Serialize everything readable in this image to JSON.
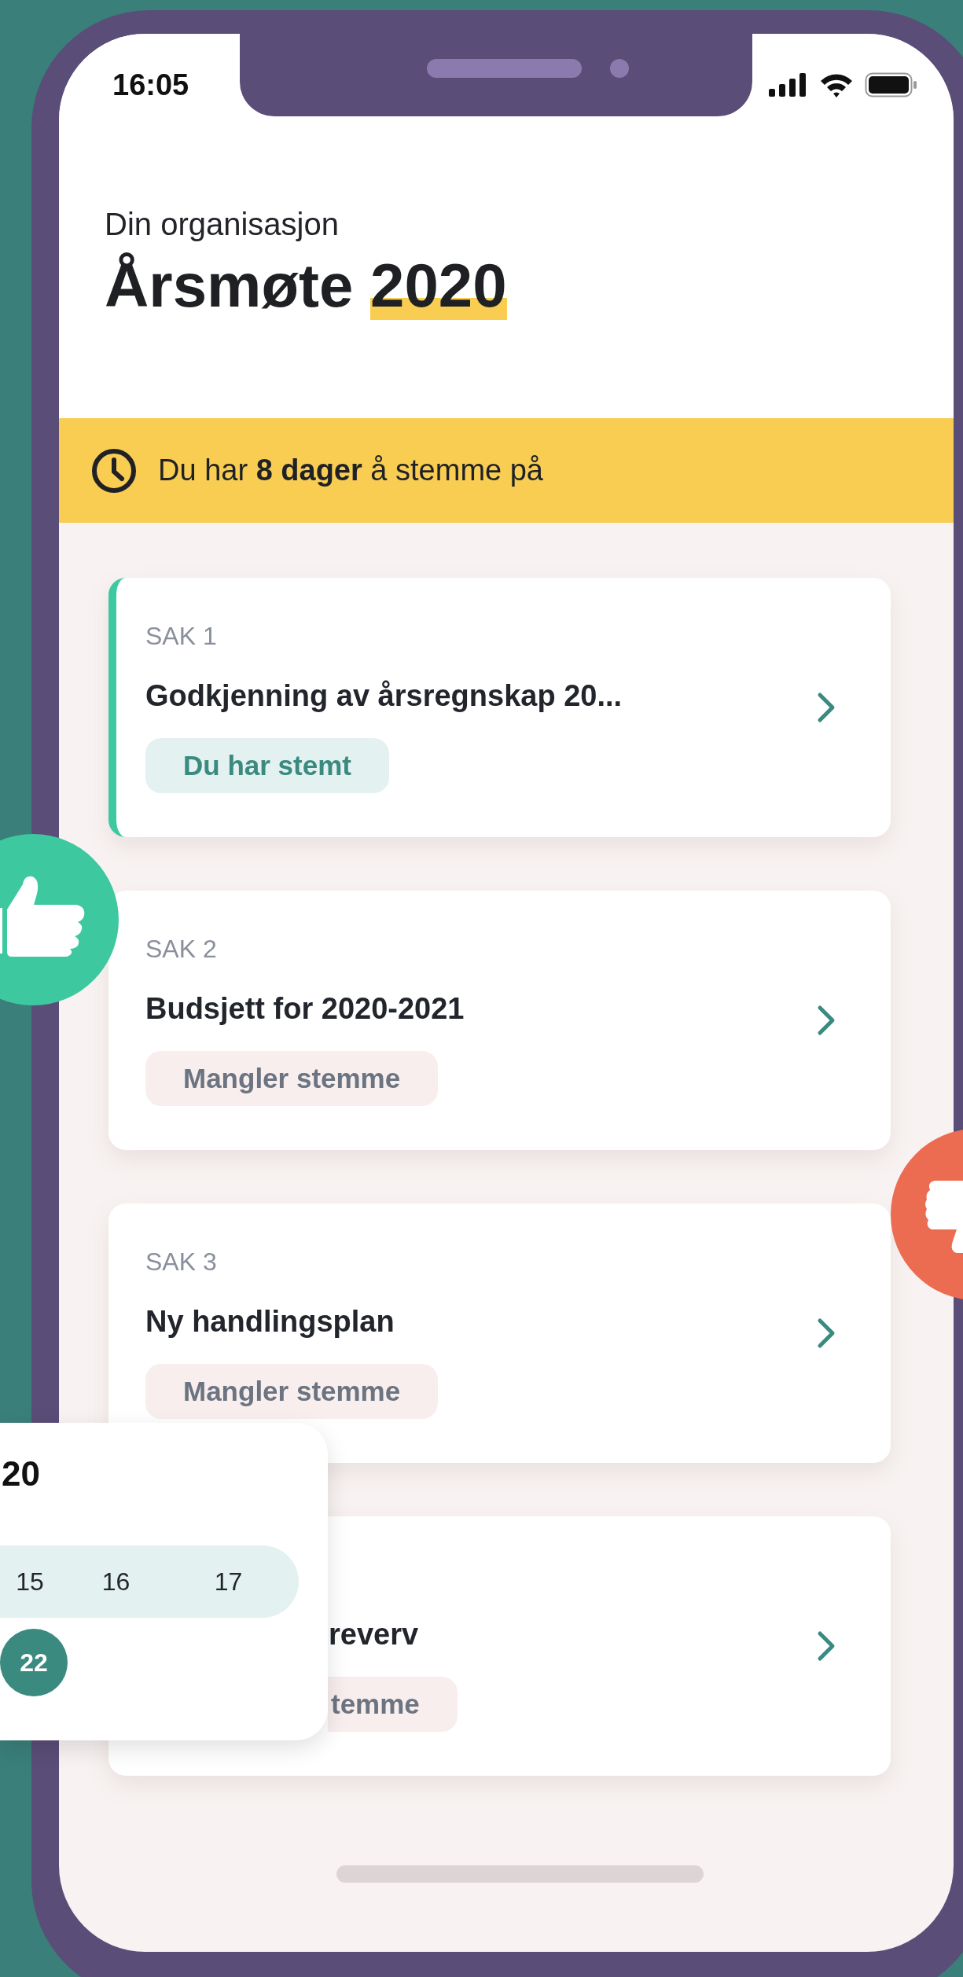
{
  "status_bar": {
    "time": "16:05"
  },
  "header": {
    "subtitle": "Din organisasjon",
    "title": "Årsmøte",
    "title_highlight": "2020"
  },
  "banner": {
    "text": "Du har **8 dager** å stemme på"
  },
  "cases": [
    {
      "label": "SAK 1",
      "title": "Godkjenning av årsregnskap 20...",
      "status": "Du har stemt",
      "voted": true,
      "covered": false
    },
    {
      "label": "SAK 2",
      "title": "Budsjett for 2020-2021",
      "status": "Mangler stemme",
      "voted": false,
      "covered": false
    },
    {
      "label": "SAK 3",
      "title": "Ny handlingsplan",
      "status": "Mangler stemme",
      "voted": false,
      "covered": false
    },
    {
      "title": "reverv",
      "status": "temme",
      "voted": false,
      "covered": true
    }
  ],
  "calendar_popup": {
    "heading": "20",
    "weeks": [
      {
        "in_range": true,
        "days": [
          {
            "day": "15",
            "selected": false
          },
          {
            "day": "16",
            "selected": false
          },
          {
            "day": "17",
            "selected": false
          }
        ]
      },
      {
        "in_range": false,
        "days": [
          {
            "day": "22",
            "selected": true
          }
        ]
      }
    ]
  }
}
